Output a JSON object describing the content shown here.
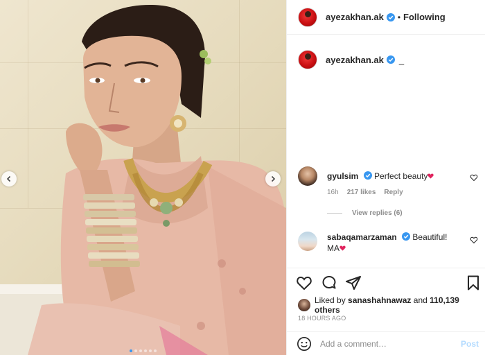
{
  "post": {
    "author": "ayezakhan.ak",
    "follow_status": "Following",
    "bullet": "•",
    "caption_text": "_"
  },
  "comments": [
    {
      "user": "gyulsim",
      "text": "Perfect beauty",
      "emoji": "heart",
      "time": "16h",
      "likes": "217 likes",
      "reply": "Reply",
      "view_replies": "View replies (6)"
    },
    {
      "user": "sabaqamarzaman",
      "text": "Beautiful!",
      "text2": "MA",
      "emoji": "heart"
    }
  ],
  "likes": {
    "prefix": "Liked by",
    "user": "sanashahnawaz",
    "and": "and",
    "others": "110,139 others"
  },
  "timestamp": "18 HOURS AGO",
  "add_comment": {
    "placeholder": "Add a comment…",
    "post_label": "Post"
  },
  "carousel": {
    "count": 6,
    "active_index": 0
  },
  "colors": {
    "accent": "#3897f0",
    "text": "#262626",
    "muted": "#8e8e8e",
    "heart": "#e0245e",
    "post_disabled": "#b3dbff"
  },
  "icons": [
    "verified-badge-icon",
    "heart-icon",
    "comment-icon",
    "share-icon",
    "save-icon",
    "smile-icon",
    "chevron-left-icon",
    "chevron-right-icon"
  ]
}
